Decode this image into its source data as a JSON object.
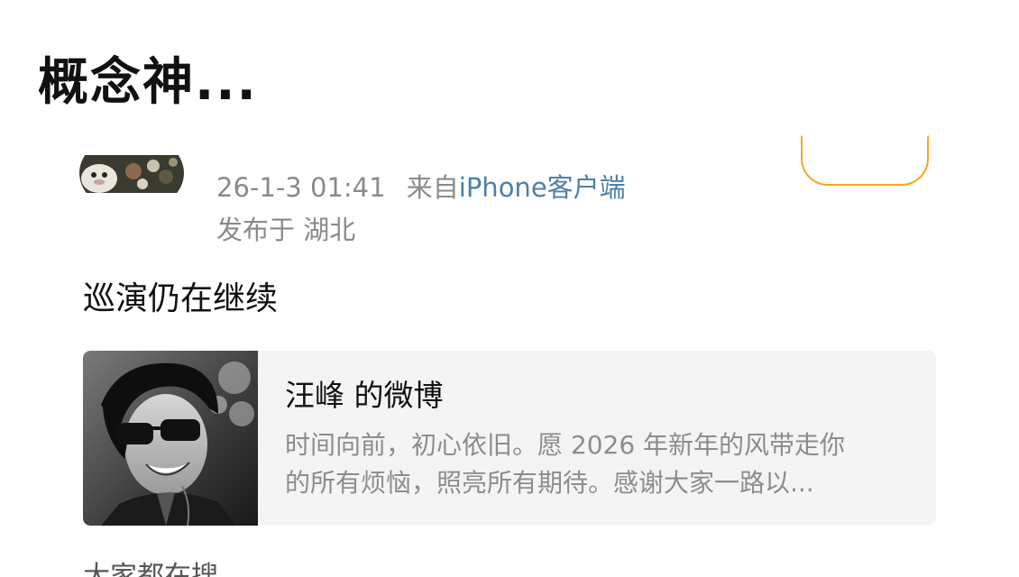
{
  "header": {
    "title": "概念神..."
  },
  "post": {
    "time": "26-1-3 01:41",
    "from_prefix": "来自",
    "source": "iPhone客户端",
    "location": "发布于 湖北",
    "text": "巡演仍在继续",
    "avatar_icon": "user-avatar-icon",
    "follow_button_color": "#f5a623"
  },
  "shared_card": {
    "title": "汪峰 的微博",
    "desc_line1": "时间向前，初心依旧。愿 2026 年新年的风带走你",
    "desc_line2": "的所有烦恼，照亮所有期待。感谢大家一路以...",
    "thumb_icon": "portrait-photo-icon"
  },
  "footer": {
    "hot_search": "大家都在搜"
  },
  "colors": {
    "source_link": "#4e7fa8",
    "meta_gray": "#8a8a8a",
    "card_bg": "#f4f4f4"
  }
}
